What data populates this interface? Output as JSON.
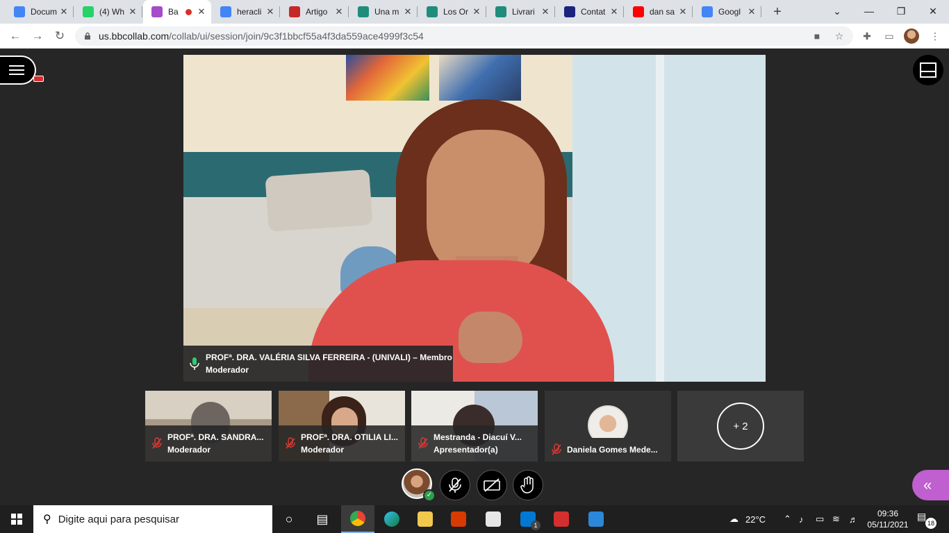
{
  "browser": {
    "tabs": [
      {
        "title": "Docum",
        "favicon": "docs-icon",
        "color": "#4285f4"
      },
      {
        "title": "(4) Wh",
        "favicon": "whatsapp-icon",
        "color": "#25d366"
      },
      {
        "title": "Ba",
        "favicon": "blackboard-icon",
        "color": "#a64bc9",
        "recording": true
      },
      {
        "title": "heracli",
        "favicon": "google-icon",
        "color": "#4285f4"
      },
      {
        "title": "Artigo",
        "favicon": "scielo-icon",
        "color": "#c62828"
      },
      {
        "title": "Una m",
        "favicon": "globe-icon",
        "color": "#1f8c7c"
      },
      {
        "title": "Los Or",
        "favicon": "globe-icon",
        "color": "#1f8c7c"
      },
      {
        "title": "Livrari",
        "favicon": "globe-icon",
        "color": "#1f8c7c"
      },
      {
        "title": "Contat",
        "favicon": "site-icon",
        "color": "#1a237e"
      },
      {
        "title": "dan sa",
        "favicon": "youtube-icon",
        "color": "#ff0000"
      },
      {
        "title": "Googl",
        "favicon": "google-icon",
        "color": "#4285f4"
      }
    ],
    "new_tab": "+",
    "url_host": "us.bbcollab.com",
    "url_path": "/collab/ui/session/join/9c3f1bbcf55a4f3da559ace4999f3c54"
  },
  "session": {
    "main_speaker": {
      "name_line1": "PROFª. DRA. VALÉRIA SILVA FERREIRA - (UNIVALI) – Membro",
      "name_line2": "Moderador"
    },
    "participants": [
      {
        "name": "PROFª. DRA. SANDRA...",
        "role": "Moderador"
      },
      {
        "name": "PROFª. DRA. OTILIA LI...",
        "role": "Moderador"
      },
      {
        "name": "Mestranda - Diacuí V...",
        "role": "Apresentador(a)"
      },
      {
        "name": "Daniela Gomes Mede...",
        "role": ""
      }
    ],
    "more_count": "+ 2"
  },
  "taskbar": {
    "search_placeholder": "Digite aqui para pesquisar",
    "weather": "22°C",
    "time": "09:36",
    "date": "05/11/2021",
    "notifications": "18",
    "mail_badge": "1"
  }
}
